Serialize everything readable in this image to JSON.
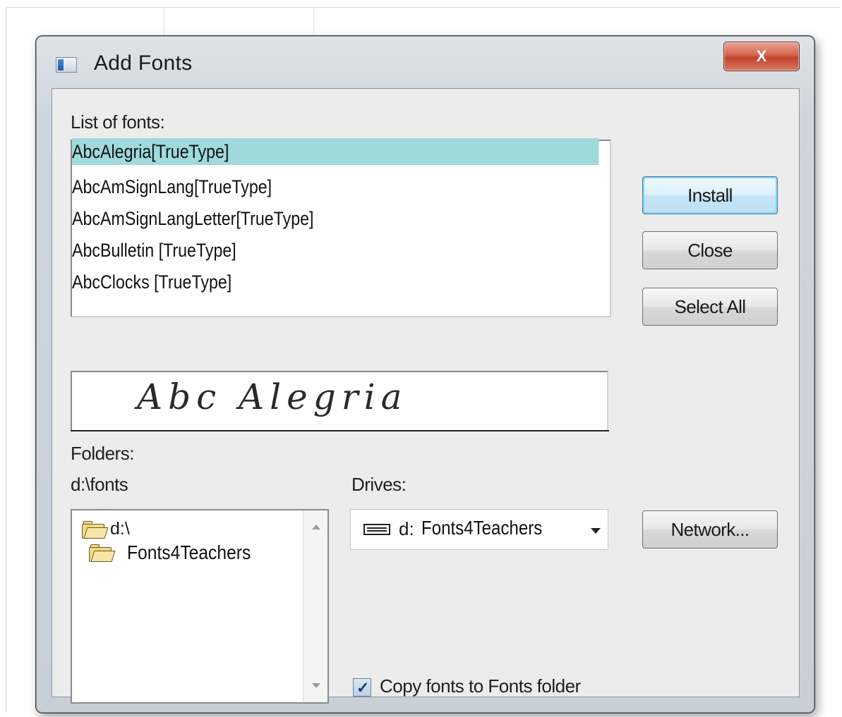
{
  "window": {
    "title": "Add Fonts",
    "close_glyph": "X"
  },
  "font_list": {
    "label": "List of fonts:",
    "items": [
      "AbcAlegria[TrueType]",
      "AbcAmSignLang[TrueType]",
      "AbcAmSignLangLetter[TrueType]",
      "AbcBulletin [TrueType]",
      "AbcClocks [TrueType]"
    ],
    "selected_index": 0,
    "selected_color": "#9fd9dc"
  },
  "preview": {
    "text": "Abc Alegria"
  },
  "folders": {
    "label": "Folders:",
    "current_path": "d:\\fonts",
    "tree": [
      {
        "name": "d:\\",
        "icon": "open-folder-icon"
      },
      {
        "name": "Fonts4Teachers",
        "icon": "open-folder-icon"
      }
    ]
  },
  "drives": {
    "label": "Drives:",
    "letter": "d:",
    "name": "Fonts4Teachers",
    "icon": "drive-icon"
  },
  "buttons": {
    "install": "Install",
    "close": "Close",
    "select_all": "Select All",
    "network": "Network..."
  },
  "copy_fonts": {
    "label": "Copy fonts to Fonts folder",
    "checked": true
  }
}
